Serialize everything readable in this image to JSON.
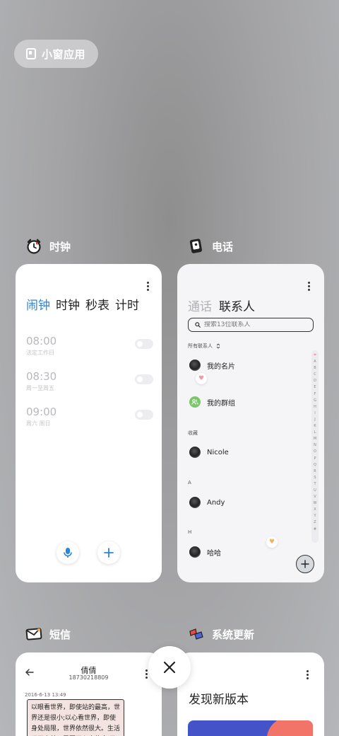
{
  "floating_window": {
    "label": "小窗应用"
  },
  "apps": {
    "clock": {
      "name": "时钟",
      "tabs": [
        "闹钟",
        "时钟",
        "秒表",
        "计时"
      ],
      "active_tab": 0,
      "alarms": [
        {
          "time": "08:00",
          "repeat": "法定工作日"
        },
        {
          "time": "08:30",
          "repeat": "周一至周五"
        },
        {
          "time": "09:00",
          "repeat": "周六 周日"
        }
      ]
    },
    "phone": {
      "name": "电话",
      "tabs": [
        "通话",
        "联系人"
      ],
      "active_tab": 1,
      "search_placeholder": "搜索13位联系人",
      "all_contacts_label": "所有联系人",
      "my_card": "我的名片",
      "my_groups": "我的群组",
      "sections": [
        {
          "header": "收藏",
          "contact": "Nicole"
        },
        {
          "header": "A",
          "contact": "Andy"
        },
        {
          "header": "H",
          "contact": "哈哈"
        }
      ],
      "index_letters": [
        "❤",
        "A",
        "B",
        "C",
        "D",
        "E",
        "F",
        "G",
        "H",
        "I",
        "J",
        "K",
        "L",
        "M",
        "N",
        "O",
        "P",
        "Q",
        "R",
        "S",
        "T",
        "U",
        "V",
        "W",
        "X",
        "Y",
        "Z",
        "#"
      ]
    },
    "messages": {
      "name": "短信",
      "contact_name": "倩倩",
      "contact_number": "18730218809",
      "timestamp": "2016-6-13 13:49",
      "message": "以眼看世界，即使站的最高，世界还是很小;以心看世界，即使身处局限，世界依然很大。生活远不完美，需要用心去体会;无需用在太"
    },
    "updater": {
      "name": "系统更新",
      "title": "发现新版本"
    }
  },
  "colors": {
    "accent_blue": "#2e84d8",
    "banner_blue": "#4553c9",
    "banner_coral": "#f27468",
    "group_green": "#7bc66c"
  }
}
